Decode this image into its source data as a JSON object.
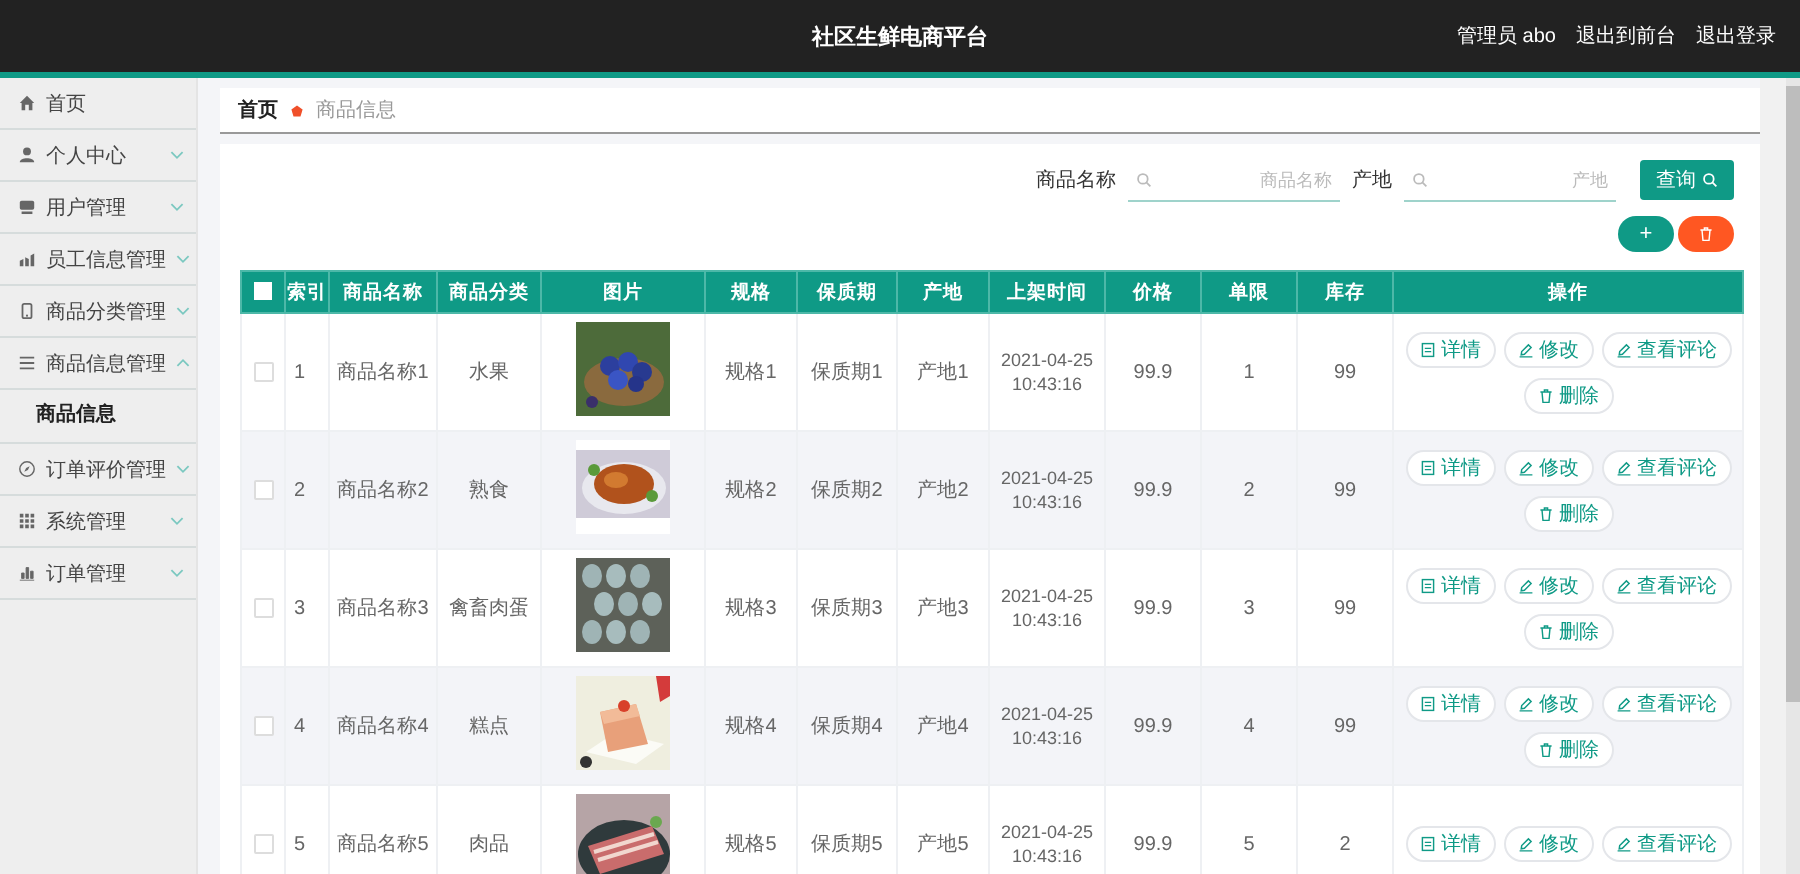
{
  "header": {
    "title": "社区生鲜电商平台",
    "links": [
      "管理员 abo",
      "退出到前台",
      "退出登录"
    ]
  },
  "sidebar": {
    "items": [
      {
        "label": "首页"
      },
      {
        "label": "个人中心",
        "expanded": false
      },
      {
        "label": "用户管理",
        "expanded": false
      },
      {
        "label": "员工信息管理",
        "expanded": false
      },
      {
        "label": "商品分类管理",
        "expanded": false
      },
      {
        "label": "商品信息管理",
        "expanded": true,
        "children": [
          {
            "label": "商品信息",
            "selected": true
          }
        ]
      },
      {
        "label": "订单评价管理",
        "expanded": false
      },
      {
        "label": "系统管理",
        "expanded": false
      },
      {
        "label": "订单管理",
        "expanded": false
      }
    ]
  },
  "breadcrumb": [
    "首页",
    "商品信息"
  ],
  "search": {
    "fields": [
      {
        "label": "商品名称",
        "placeholder": "商品名称"
      },
      {
        "label": "产地",
        "placeholder": "产地"
      }
    ],
    "button": "查询"
  },
  "toolbar": {
    "add": "+"
  },
  "table": {
    "select_all": {
      "checked": false
    },
    "columns": [
      "索引",
      "商品名称",
      "商品分类",
      "图片",
      "规格",
      "保质期",
      "产地",
      "上架时间",
      "价格",
      "单限",
      "库存",
      "操作"
    ],
    "rows": [
      {
        "checked": false,
        "cells": [
          "1",
          "商品名称1",
          "水果",
          {
            "kind": "picture"
          },
          "规格1",
          "保质期1",
          "产地1",
          "2021-04-25 10:43:16",
          "99.9",
          "1",
          "99"
        ],
        "actions": [
          {
            "kind": "detail",
            "label": "详情"
          },
          {
            "kind": "edit",
            "label": "修改"
          },
          {
            "kind": "edit",
            "label": "查看评论"
          },
          {
            "kind": "delete",
            "label": "删除"
          }
        ]
      },
      {
        "checked": false,
        "cells": [
          "2",
          "商品名称2",
          "熟食",
          {
            "kind": "picture"
          },
          "规格2",
          "保质期2",
          "产地2",
          "2021-04-25 10:43:16",
          "99.9",
          "2",
          "99"
        ],
        "actions": [
          {
            "kind": "detail",
            "label": "详情"
          },
          {
            "kind": "edit",
            "label": "修改"
          },
          {
            "kind": "edit",
            "label": "查看评论"
          },
          {
            "kind": "delete",
            "label": "删除"
          }
        ]
      },
      {
        "checked": false,
        "cells": [
          "3",
          "商品名称3",
          "禽畜肉蛋",
          {
            "kind": "picture"
          },
          "规格3",
          "保质期3",
          "产地3",
          "2021-04-25 10:43:16",
          "99.9",
          "3",
          "99"
        ],
        "actions": [
          {
            "kind": "detail",
            "label": "详情"
          },
          {
            "kind": "edit",
            "label": "修改"
          },
          {
            "kind": "edit",
            "label": "查看评论"
          },
          {
            "kind": "delete",
            "label": "删除"
          }
        ]
      },
      {
        "checked": false,
        "cells": [
          "4",
          "商品名称4",
          "糕点",
          {
            "kind": "picture"
          },
          "规格4",
          "保质期4",
          "产地4",
          "2021-04-25 10:43:16",
          "99.9",
          "4",
          "99"
        ],
        "actions": [
          {
            "kind": "detail",
            "label": "详情"
          },
          {
            "kind": "edit",
            "label": "修改"
          },
          {
            "kind": "edit",
            "label": "查看评论"
          },
          {
            "kind": "delete",
            "label": "删除"
          }
        ]
      },
      {
        "checked": false,
        "cells": [
          "5",
          "商品名称5",
          "肉品",
          {
            "kind": "picture"
          },
          "规格5",
          "保质期5",
          "产地5",
          "2021-04-25 10:43:16",
          "99.9",
          "5",
          "2"
        ],
        "actions": [
          {
            "kind": "detail",
            "label": "详情"
          },
          {
            "kind": "edit",
            "label": "修改"
          },
          {
            "kind": "edit",
            "label": "查看评论"
          }
        ]
      }
    ]
  }
}
